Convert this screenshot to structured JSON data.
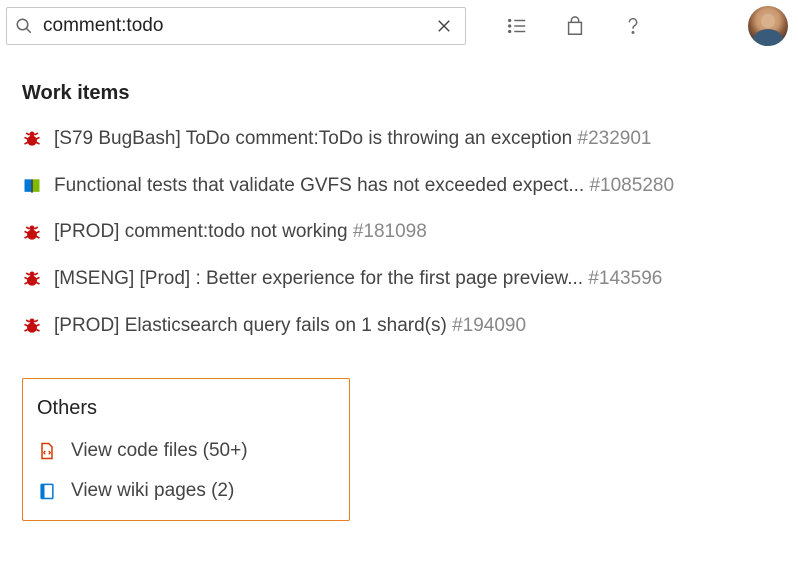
{
  "search": {
    "value": "comment:todo"
  },
  "sections": {
    "work_items": {
      "title": "Work items",
      "items": [
        {
          "icon": "bug",
          "text": "[S79 BugBash] ToDo comment:ToDo is throwing an exception ",
          "id": "#232901"
        },
        {
          "icon": "book",
          "text": "Functional tests that validate GVFS has not exceeded expect... ",
          "id": "#1085280"
        },
        {
          "icon": "bug",
          "text": "[PROD] comment:todo not working ",
          "id": "#181098"
        },
        {
          "icon": "bug",
          "text": "[MSENG] [Prod] : Better experience for the first page preview... ",
          "id": "#143596"
        },
        {
          "icon": "bug",
          "text": "[PROD] Elasticsearch query fails on 1 shard(s) ",
          "id": "#194090"
        }
      ]
    },
    "others": {
      "title": "Others",
      "items": [
        {
          "icon": "code-file",
          "label": "View code files (50+)"
        },
        {
          "icon": "wiki",
          "label": "View wiki pages (2)"
        }
      ]
    }
  }
}
